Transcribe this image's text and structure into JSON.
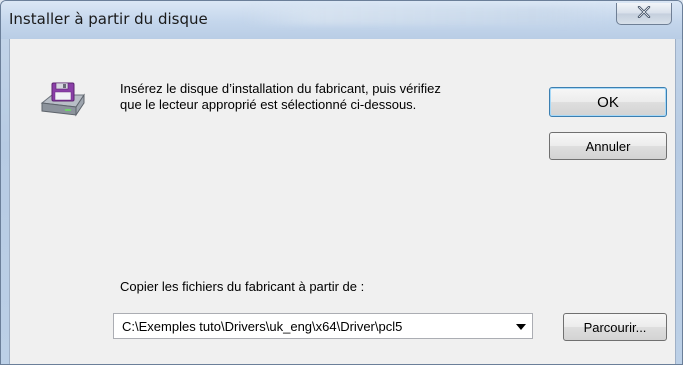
{
  "window": {
    "title": "Installer à partir du disque",
    "close_icon": "close-icon"
  },
  "dialog": {
    "icon": "floppy-disk-drive-icon",
    "message_line1": "Insérez le disque d’installation du fabricant, puis vérifiez",
    "message_line2": "que le lecteur approprié est sélectionné ci-dessous.",
    "ok_label": "OK",
    "cancel_label": "Annuler",
    "copy_label": "Copier les fichiers du fabricant à partir de :",
    "path_value": "C:\\Exemples tuto\\Drivers\\uk_eng\\x64\\Driver\\pcl5",
    "browse_label": "Parcourir..."
  }
}
